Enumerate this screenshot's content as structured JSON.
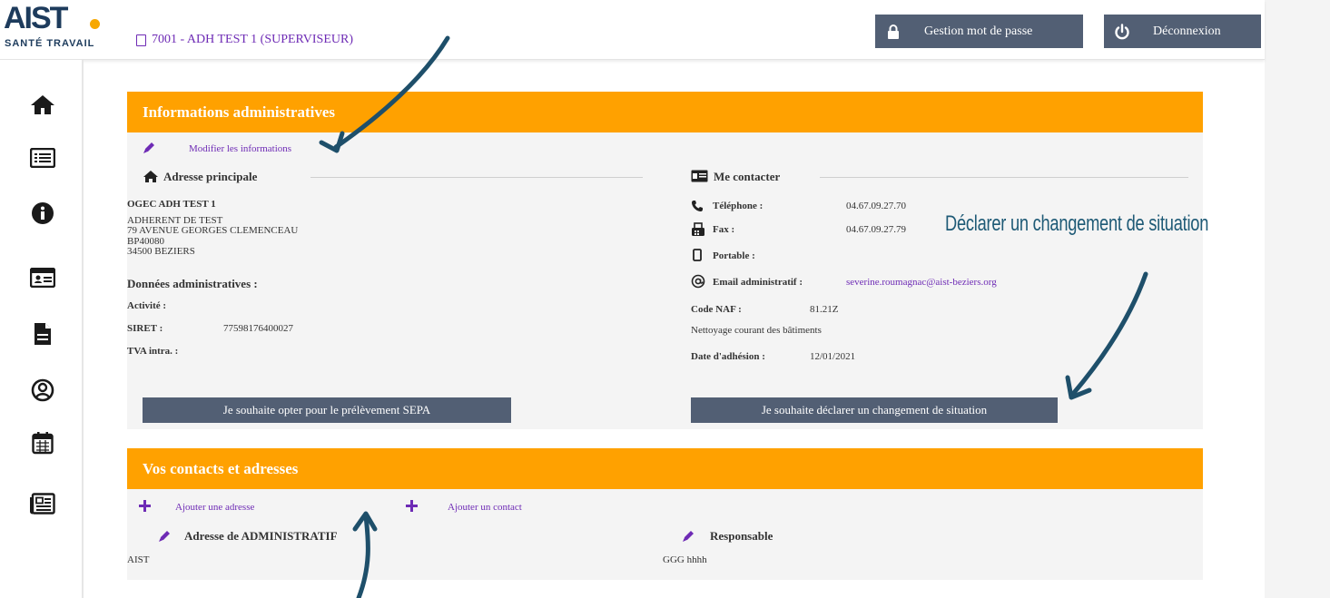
{
  "topbar": {
    "logo_main": "AIST",
    "logo_sub": "SANTÉ TRAVAIL",
    "company_label": "7001 - ADH TEST 1 (SUPERVISEUR)",
    "password_button": "Gestion mot de passe",
    "logout_button": "Déconnexion"
  },
  "sidebar": {
    "items": [
      "home-icon",
      "list-icon",
      "info-icon",
      "id-card-icon",
      "document-icon",
      "user-icon",
      "calendar-icon",
      "newspaper-icon"
    ]
  },
  "admin": {
    "title": "Informations administratives",
    "modify_link": "Modifier les informations",
    "address_heading": "Adresse principale",
    "company_name": "OGEC ADH TEST 1",
    "address_lines": [
      "ADHERENT DE TEST",
      "79 AVENUE GEORGES CLEMENCEAU",
      "BP40080",
      "34500 BEZIERS"
    ],
    "admin_data_heading": "Données administratives :",
    "activity_label": "Activité :",
    "siret_label": "SIRET :",
    "siret_value": "77598176400027",
    "tva_label": "TVA intra. :",
    "sepa_button": "Je souhaite opter pour le prélèvement SEPA",
    "contact_heading": "Me contacter",
    "phone_label": "Téléphone :",
    "phone_value": "04.67.09.27.70",
    "fax_label": "Fax :",
    "fax_value": "04.67.09.27.79",
    "mobile_label": "Portable :",
    "email_label": "Email administratif :",
    "email_value": "severine.roumagnac@aist-beziers.org",
    "naf_label": "Code NAF :",
    "naf_value": "81.21Z",
    "naf_desc": "Nettoyage courant des bâtiments",
    "join_label": "Date d'adhésion :",
    "join_value": "12/01/2021",
    "change_button": "Je souhaite déclarer un changement de situation"
  },
  "contacts": {
    "title": "Vos contacts et adresses",
    "add_address": "Ajouter une adresse",
    "add_contact": "Ajouter un contact",
    "address_card_title": "Adresse de ADMINISTRATIF",
    "address_card_value": "AIST",
    "contact_card_title": "Responsable",
    "contact_card_value": "GGG hhhh"
  },
  "annotation": {
    "text": "Déclarer un changement de situation"
  },
  "colors": {
    "orange": "#ffa100",
    "button": "#525f74",
    "purple": "#6e2bb5",
    "annotation": "#1e5a76"
  }
}
